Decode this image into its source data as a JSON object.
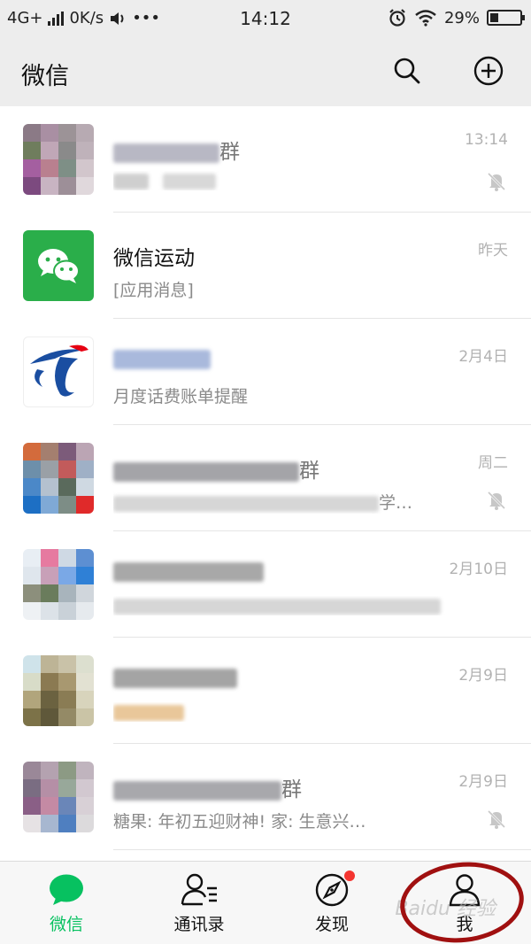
{
  "status_bar": {
    "network": "4G+",
    "speed": "0K/s",
    "more": "•••",
    "time": "14:12",
    "battery": "29%",
    "battery_level": 0.29
  },
  "header": {
    "title": "微信",
    "search_icon": "search-icon",
    "add_icon": "plus-circle-icon"
  },
  "chats": [
    {
      "name": "群",
      "preview": "",
      "time": "13:14",
      "muted": true
    },
    {
      "name": "微信运动",
      "preview": "[应用消息]",
      "time": "昨天",
      "muted": false
    },
    {
      "name": "",
      "preview": "月度话费账单提醒",
      "time": "2月4日",
      "muted": false
    },
    {
      "name": "群",
      "preview": "学…",
      "time": "周二",
      "muted": true
    },
    {
      "name": "",
      "preview": "",
      "time": "2月10日",
      "muted": false
    },
    {
      "name": "",
      "preview": "",
      "time": "2月9日",
      "muted": false
    },
    {
      "name": "群",
      "preview": "糖果: 年初五迎财神! 家: 生意兴…",
      "time": "2月9日",
      "muted": true
    }
  ],
  "tabs": [
    {
      "label": "微信",
      "icon": "chat-bubble-icon",
      "active": true
    },
    {
      "label": "通讯录",
      "icon": "contacts-icon",
      "active": false
    },
    {
      "label": "发现",
      "icon": "compass-icon",
      "active": false,
      "badge": true
    },
    {
      "label": "我",
      "icon": "person-icon",
      "active": false
    }
  ],
  "colors": {
    "accent_green": "#07c160",
    "badge_red": "#f43530",
    "annotation_red": "#a01010"
  },
  "watermark": "Baidu 经验"
}
